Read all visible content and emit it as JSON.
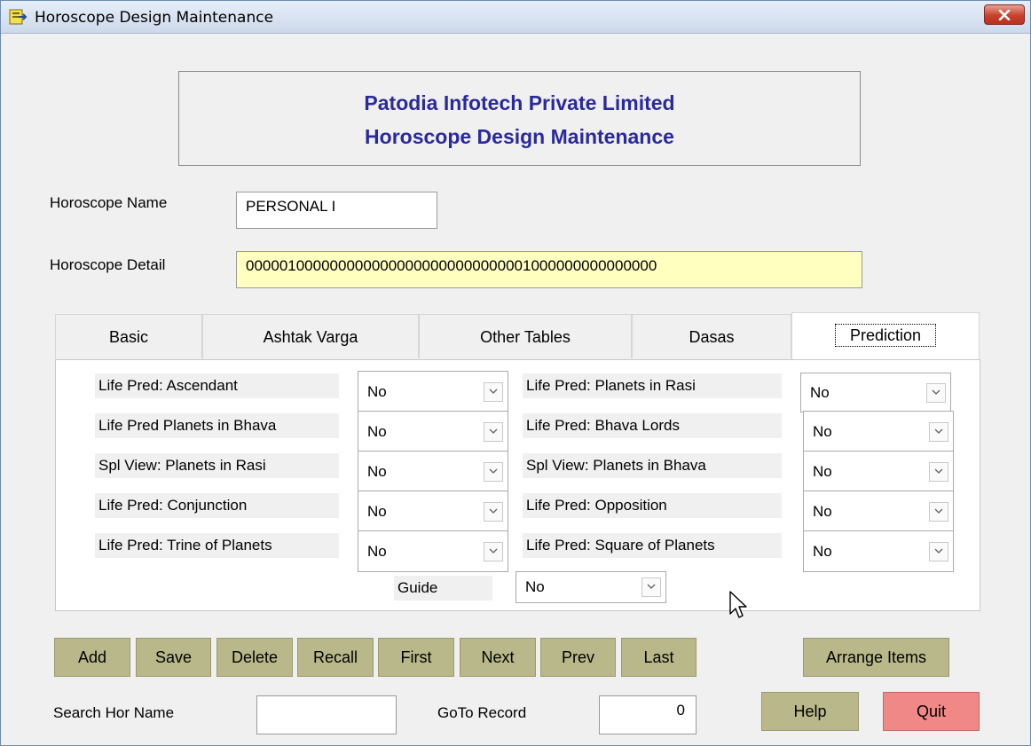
{
  "window": {
    "title": "Horoscope Design Maintenance"
  },
  "header": {
    "company": "Patodia Infotech Private Limited",
    "subtitle": "Horoscope Design Maintenance"
  },
  "form": {
    "name_label": "Horoscope Name",
    "name_value": "PERSONAL I",
    "detail_label": "Horoscope Detail",
    "detail_value": "0000010000000000000000000000000001000000000000000"
  },
  "tabs": [
    {
      "label": "Basic"
    },
    {
      "label": "Ashtak Varga"
    },
    {
      "label": "Other Tables"
    },
    {
      "label": "Dasas"
    },
    {
      "label": "Prediction",
      "active": true
    }
  ],
  "prediction": {
    "left": [
      {
        "label": "Life Pred: Ascendant",
        "value": "No"
      },
      {
        "label": "Life Pred Planets in Bhava",
        "value": "No"
      },
      {
        "label": "Spl View: Planets in Rasi",
        "value": "No"
      },
      {
        "label": "Life Pred: Conjunction",
        "value": "No"
      },
      {
        "label": "Life Pred: Trine of Planets",
        "value": "No"
      }
    ],
    "right": [
      {
        "label": "Life Pred: Planets in Rasi",
        "value": "No"
      },
      {
        "label": "Life Pred: Bhava Lords",
        "value": "No"
      },
      {
        "label": "Spl View: Planets in Bhava",
        "value": "No"
      },
      {
        "label": "Life Pred: Opposition",
        "value": "No"
      },
      {
        "label": "Life Pred: Square of Planets",
        "value": "No"
      }
    ],
    "guide_label": "Guide",
    "guide_value": "No"
  },
  "buttons": {
    "add": "Add",
    "save": "Save",
    "delete": "Delete",
    "recall": "Recall",
    "first": "First",
    "next": "Next",
    "prev": "Prev",
    "last": "Last",
    "arrange": "Arrange Items",
    "help": "Help",
    "quit": "Quit"
  },
  "footer": {
    "search_label": "Search Hor Name",
    "search_value": "",
    "goto_label": "GoTo Record",
    "goto_value": "0"
  },
  "colors": {
    "header_text": "#2a2a9c",
    "detail_bg": "#ffffc0",
    "button_bg": "#b8b88a",
    "quit_bg": "#f08888"
  }
}
